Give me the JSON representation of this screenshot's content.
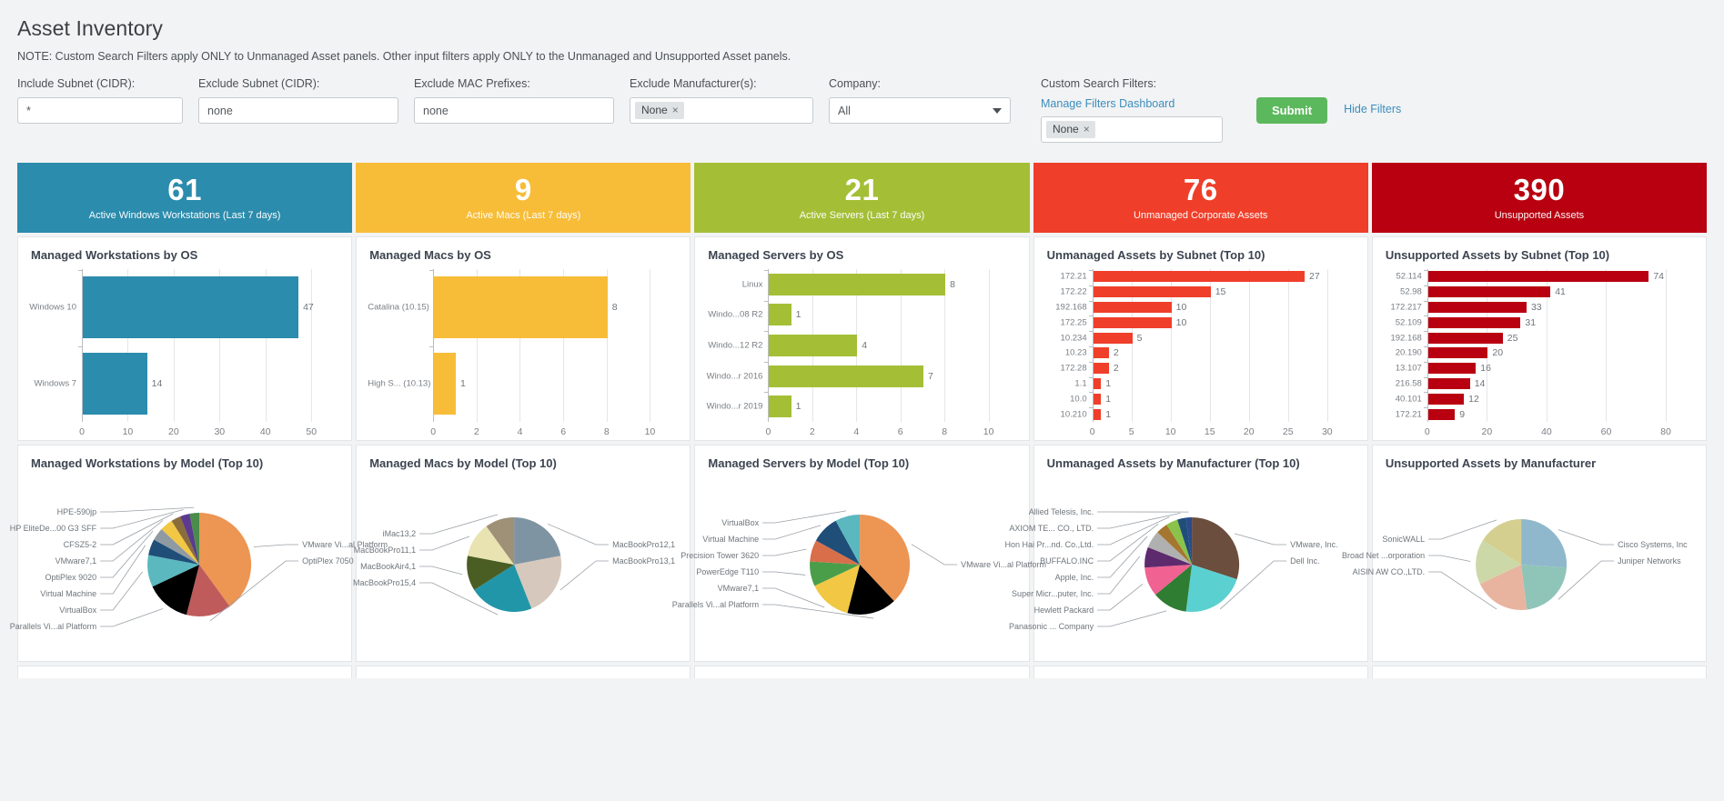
{
  "header": {
    "title": "Asset Inventory",
    "note": "NOTE: Custom Search Filters apply ONLY to Unmanaged Asset panels. Other input filters apply ONLY to the Unmanaged and Unsupported Asset panels."
  },
  "filters": {
    "include_subnet": {
      "label": "Include Subnet (CIDR):",
      "value": "*"
    },
    "exclude_subnet": {
      "label": "Exclude Subnet (CIDR):",
      "value": "none"
    },
    "exclude_mac": {
      "label": "Exclude MAC Prefixes:",
      "value": "none"
    },
    "exclude_manufacturer": {
      "label": "Exclude Manufacturer(s):",
      "token": "None",
      "token_x": "×"
    },
    "company": {
      "label": "Company:",
      "value": "All"
    },
    "custom_search": {
      "label": "Custom Search Filters:",
      "link": "Manage Filters Dashboard",
      "token": "None",
      "token_x": "×"
    },
    "submit_label": "Submit",
    "hide_filters_label": "Hide Filters"
  },
  "kpis": [
    {
      "value": "61",
      "label": "Active Windows Workstations (Last 7 days)",
      "color": "#2b8cad"
    },
    {
      "value": "9",
      "label": "Active Macs (Last 7 days)",
      "color": "#f7bd38"
    },
    {
      "value": "21",
      "label": "Active Servers (Last 7 days)",
      "color": "#a4bf36"
    },
    {
      "value": "76",
      "label": "Unmanaged Corporate Assets",
      "color": "#ef3f2a"
    },
    {
      "value": "390",
      "label": "Unsupported Assets",
      "color": "#b80010"
    }
  ],
  "chart_data": [
    {
      "id": "managed-workstations-by-os",
      "type": "bar",
      "orientation": "horizontal",
      "title": "Managed Workstations by OS",
      "categories": [
        "Windows 10",
        "Windows 7"
      ],
      "values": [
        47,
        14
      ],
      "color": "#2b8cad",
      "xlim": [
        0,
        50
      ],
      "xticks": [
        0,
        10,
        20,
        30,
        40,
        50
      ],
      "xlabel": "",
      "ylabel": "",
      "grid": true
    },
    {
      "id": "managed-macs-by-os",
      "type": "bar",
      "orientation": "horizontal",
      "title": "Managed Macs by OS",
      "categories": [
        "Catalina (10.15)",
        "High S... (10.13)"
      ],
      "values": [
        8,
        1
      ],
      "color": "#f7bd38",
      "xlim": [
        0,
        10
      ],
      "xticks": [
        0,
        2,
        4,
        6,
        8,
        10
      ],
      "xlabel": "",
      "ylabel": "",
      "grid": true
    },
    {
      "id": "managed-servers-by-os",
      "type": "bar",
      "orientation": "horizontal",
      "title": "Managed Servers by OS",
      "categories": [
        "Linux",
        "Windo...08 R2",
        "Windo...12 R2",
        "Windo...r 2016",
        "Windo...r 2019"
      ],
      "values": [
        8,
        1,
        4,
        7,
        1
      ],
      "color": "#a4bf36",
      "xlim": [
        0,
        10
      ],
      "xticks": [
        0,
        2,
        4,
        6,
        8,
        10
      ],
      "xlabel": "",
      "ylabel": "",
      "grid": true
    },
    {
      "id": "unmanaged-assets-by-subnet",
      "type": "bar",
      "orientation": "horizontal",
      "title": "Unmanaged Assets by Subnet (Top 10)",
      "categories": [
        "172.21",
        "172.22",
        "192.168",
        "172.25",
        "10.234",
        "10.23",
        "172.28",
        "1.1",
        "10.0",
        "10.210"
      ],
      "values": [
        27,
        15,
        10,
        10,
        5,
        2,
        2,
        1,
        1,
        1
      ],
      "color": "#ef3f2a",
      "xlim": [
        0,
        30
      ],
      "xticks": [
        0,
        5,
        10,
        15,
        20,
        25,
        30
      ],
      "xlabel": "",
      "ylabel": "",
      "grid": true
    },
    {
      "id": "unsupported-assets-by-subnet",
      "type": "bar",
      "orientation": "horizontal",
      "title": "Unsupported Assets by Subnet (Top 10)",
      "categories": [
        "52.114",
        "52.98",
        "172.217",
        "52.109",
        "192.168",
        "20.190",
        "13.107",
        "216.58",
        "40.101",
        "172.21"
      ],
      "values": [
        74,
        41,
        33,
        31,
        25,
        20,
        16,
        14,
        12,
        9
      ],
      "color": "#b80010",
      "xlim": [
        0,
        80
      ],
      "xticks": [
        0,
        20,
        40,
        60,
        80
      ],
      "xlabel": "",
      "ylabel": "",
      "grid": true
    },
    {
      "id": "managed-workstations-by-model",
      "type": "pie",
      "title": "Managed Workstations by Model (Top 10)",
      "labels": [
        "VMware Vi...al Platform",
        "OptiPlex 7050",
        "Parallels Vi...al Platform",
        "VirtualBox",
        "Virtual Machine",
        "OptiPlex 9020",
        "VMware7,1",
        "CFSZ5-2",
        "HP EliteDe...00 G3 SFF",
        "HPE-590jp"
      ],
      "values": [
        40,
        14,
        14,
        10,
        5,
        4,
        4,
        3,
        3,
        3
      ],
      "colors": [
        "#ed9553",
        "#bf5b5b",
        "#a9c martial",
        "#5bb8bf",
        "#1f4e79",
        "#8f9aa3",
        "#f2c744",
        "#8a6d3b",
        "#5b3a8f",
        "#4a8c4a"
      ],
      "label_side": [
        "right",
        "right",
        "left",
        "left",
        "left",
        "left",
        "left",
        "left",
        "left",
        "left"
      ]
    },
    {
      "id": "managed-macs-by-model",
      "type": "pie",
      "title": "Managed Macs by Model (Top 10)",
      "labels": [
        "MacBookPro12,1",
        "MacBookPro13,1",
        "MacBookPro15,4",
        "MacBookAir4,1",
        "MacBookPro11,1",
        "iMac13,2"
      ],
      "values": [
        22,
        22,
        22,
        12,
        12,
        10
      ],
      "colors": [
        "#7f94a3",
        "#d6c8bc",
        "#2196a8",
        "#4a5d23",
        "#e8e3b0",
        "#9e9178"
      ],
      "label_side": [
        "right",
        "right",
        "left",
        "left",
        "left",
        "left"
      ]
    },
    {
      "id": "managed-servers-by-model",
      "type": "pie",
      "title": "Managed Servers by Model (Top 10)",
      "labels": [
        "VMware Vi...al Platform",
        "Parallels Vi...al Platform",
        "VMware7,1",
        "PowerEdge T110",
        "Precision Tower 3620",
        "Virtual Machine",
        "VirtualBox"
      ],
      "values": [
        38,
        16,
        14,
        8,
        7,
        9,
        8
      ],
      "colors": [
        "#ed9553",
        "#a9c martial",
        "#f2c744",
        "#4a9e4a",
        "#d86f4a",
        "#1f4e79",
        "#5bb8bf"
      ],
      "label_side": [
        "right",
        "left",
        "left",
        "left",
        "left",
        "left",
        "left"
      ]
    },
    {
      "id": "unmanaged-assets-by-manufacturer",
      "type": "pie",
      "title": "Unmanaged Assets by Manufacturer (Top 10)",
      "labels": [
        "VMware, Inc.",
        "Dell Inc.",
        "Panasonic ... Company",
        "Hewlett Packard",
        "Super Micr...puter, Inc.",
        "Apple, Inc.",
        "BUFFALO.INC",
        "Hon Hai Pr...nd. Co.,Ltd.",
        "AXIOM TE... CO., LTD.",
        "Allied Telesis, Inc."
      ],
      "values": [
        30,
        22,
        12,
        10,
        7,
        6,
        4,
        4,
        3,
        2
      ],
      "colors": [
        "#6b4e3d",
        "#5bd0d0",
        "#2e7d32",
        "#f06292",
        "#5e2a6e",
        "#b0b0b0",
        "#a5762f",
        "#8bc34a",
        "#1f4e79",
        "#2b4a8c"
      ],
      "label_side": [
        "right",
        "right",
        "left",
        "left",
        "left",
        "left",
        "left",
        "left",
        "left",
        "left"
      ]
    },
    {
      "id": "unsupported-assets-by-manufacturer",
      "type": "pie",
      "title": "Unsupported Assets by Manufacturer",
      "labels": [
        "Cisco Systems, Inc",
        "Juniper Networks",
        "AISIN AW CO.,LTD.",
        "Broad Net ...orporation",
        "SonicWALL"
      ],
      "values": [
        26,
        22,
        20,
        16,
        16
      ],
      "colors": [
        "#8fb8cc",
        "#8fc4b8",
        "#e8b4a0",
        "#cdd8a8",
        "#d4cf8f"
      ],
      "label_side": [
        "right",
        "right",
        "left",
        "left",
        "left"
      ]
    }
  ]
}
